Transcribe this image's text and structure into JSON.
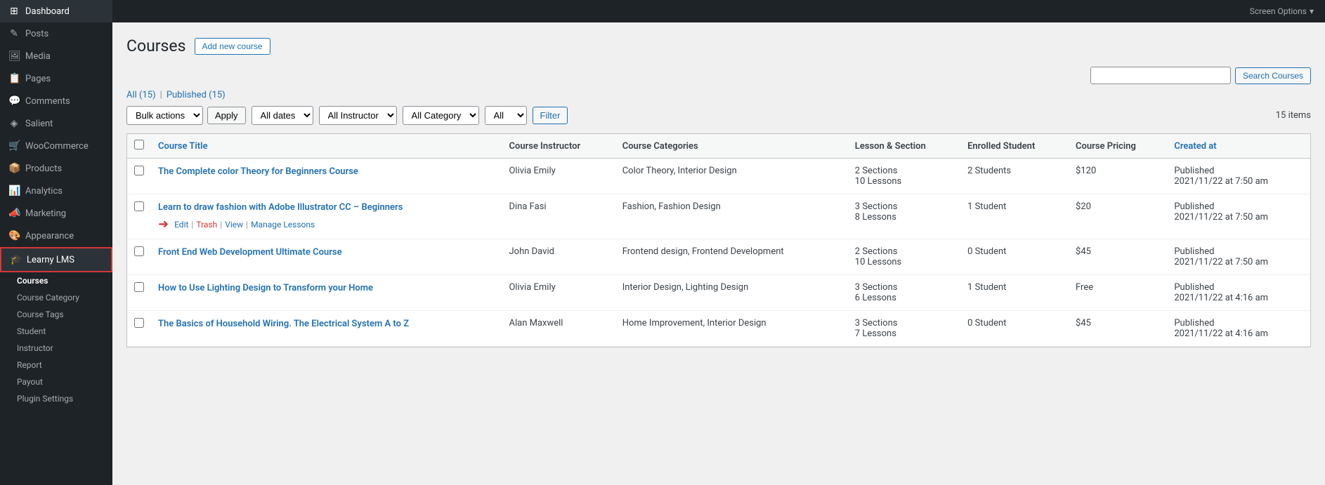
{
  "topbar": {
    "screen_options": "Screen Options"
  },
  "sidebar": {
    "items": [
      {
        "id": "dashboard",
        "label": "Dashboard",
        "icon": "⊞"
      },
      {
        "id": "posts",
        "label": "Posts",
        "icon": "📄"
      },
      {
        "id": "media",
        "label": "Media",
        "icon": "🖼"
      },
      {
        "id": "pages",
        "label": "Pages",
        "icon": "📋"
      },
      {
        "id": "comments",
        "label": "Comments",
        "icon": "💬"
      },
      {
        "id": "salient",
        "label": "Salient",
        "icon": "🎨"
      },
      {
        "id": "woocommerce",
        "label": "WooCommerce",
        "icon": "🛒"
      },
      {
        "id": "products",
        "label": "Products",
        "icon": "📦"
      },
      {
        "id": "analytics",
        "label": "Analytics",
        "icon": "📊"
      },
      {
        "id": "marketing",
        "label": "Marketing",
        "icon": "📣"
      },
      {
        "id": "appearance",
        "label": "Appearance",
        "icon": "🎨"
      },
      {
        "id": "learny-lms",
        "label": "Learny LMS",
        "icon": "🎓"
      }
    ],
    "sub_items": [
      {
        "id": "courses",
        "label": "Courses",
        "active": true
      },
      {
        "id": "course-category",
        "label": "Course Category"
      },
      {
        "id": "course-tags",
        "label": "Course Tags"
      },
      {
        "id": "student",
        "label": "Student"
      },
      {
        "id": "instructor",
        "label": "Instructor"
      },
      {
        "id": "report",
        "label": "Report"
      },
      {
        "id": "payout",
        "label": "Payout"
      },
      {
        "id": "plugin-settings",
        "label": "Plugin Settings"
      }
    ]
  },
  "page": {
    "title": "Courses",
    "add_new_label": "Add new course"
  },
  "search": {
    "placeholder": "",
    "button_label": "Search Courses"
  },
  "status_links": [
    {
      "id": "all",
      "label": "All (15)",
      "active": true
    },
    {
      "id": "published",
      "label": "Published (15)"
    }
  ],
  "filters": {
    "bulk_actions_label": "Bulk actions",
    "apply_label": "Apply",
    "dates_label": "All dates",
    "instructor_label": "All Instructor",
    "category_label": "All Category",
    "all_label": "All",
    "filter_label": "Filter",
    "items_count": "15 items"
  },
  "table": {
    "columns": [
      {
        "id": "title",
        "label": "Course Title"
      },
      {
        "id": "instructor",
        "label": "Course Instructor"
      },
      {
        "id": "categories",
        "label": "Course Categories"
      },
      {
        "id": "lesson",
        "label": "Lesson & Section"
      },
      {
        "id": "enrolled",
        "label": "Enrolled Student"
      },
      {
        "id": "pricing",
        "label": "Course Pricing"
      },
      {
        "id": "created",
        "label": "Created at"
      }
    ],
    "rows": [
      {
        "id": 1,
        "title": "The Complete color Theory for Beginners Course",
        "instructor": "Olivia Emily",
        "categories": "Color Theory, Interior Design",
        "sections": "2 Sections",
        "lessons": "10 Lessons",
        "enrolled": "2 Students",
        "pricing": "$120",
        "status": "Published",
        "date": "2021/11/22 at 7:50 am",
        "show_actions": false
      },
      {
        "id": 2,
        "title": "Learn to draw fashion with Adobe Illustrator CC – Beginners",
        "instructor": "Dina Fasi",
        "categories": "Fashion, Fashion Design",
        "sections": "3 Sections",
        "lessons": "8 Lessons",
        "enrolled": "1 Student",
        "pricing": "$20",
        "status": "Published",
        "date": "2021/11/22 at 7:50 am",
        "show_actions": true
      },
      {
        "id": 3,
        "title": "Front End Web Development Ultimate Course",
        "instructor": "John David",
        "categories": "Frontend design, Frontend Development",
        "sections": "2 Sections",
        "lessons": "10 Lessons",
        "enrolled": "0 Student",
        "pricing": "$45",
        "status": "Published",
        "date": "2021/11/22 at 7:50 am",
        "show_actions": false
      },
      {
        "id": 4,
        "title": "How to Use Lighting Design to Transform your Home",
        "instructor": "Olivia Emily",
        "categories": "Interior Design, Lighting Design",
        "sections": "3 Sections",
        "lessons": "6 Lessons",
        "enrolled": "1 Student",
        "pricing": "Free",
        "status": "Published",
        "date": "2021/11/22 at 4:16 am",
        "show_actions": false
      },
      {
        "id": 5,
        "title": "The Basics of Household Wiring. The Electrical System A to Z",
        "instructor": "Alan Maxwell",
        "categories": "Home Improvement, Interior Design",
        "sections": "3 Sections",
        "lessons": "7 Lessons",
        "enrolled": "0 Student",
        "pricing": "$45",
        "status": "Published",
        "date": "2021/11/22 at 4:16 am",
        "show_actions": false
      }
    ],
    "row_actions": {
      "edit": "Edit",
      "trash": "Trash",
      "view": "View",
      "manage": "Manage Lessons"
    }
  }
}
